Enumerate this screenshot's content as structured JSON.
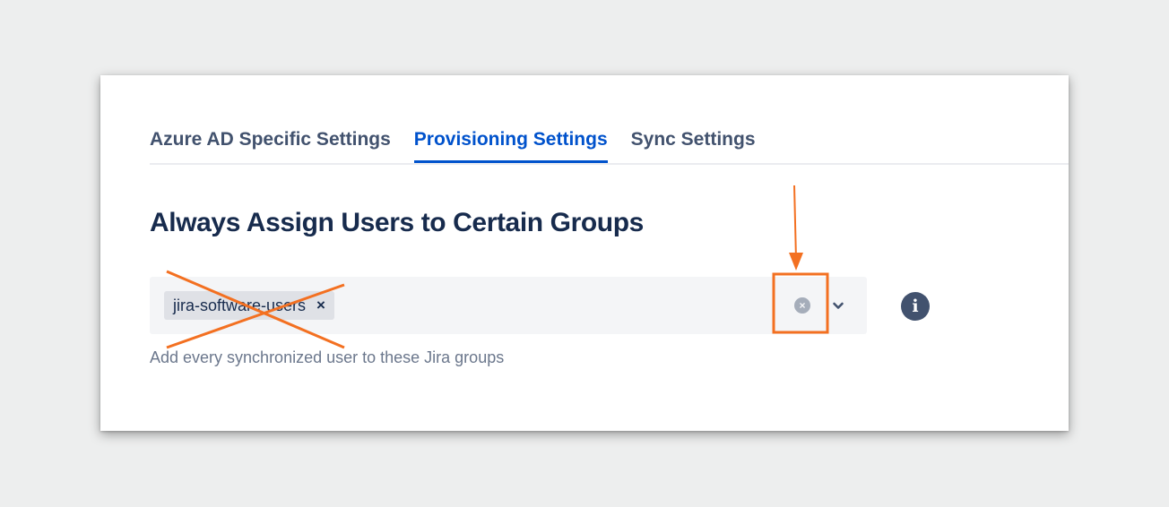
{
  "tabs": [
    {
      "label": "Azure AD Specific Settings",
      "active": false
    },
    {
      "label": "Provisioning Settings",
      "active": true
    },
    {
      "label": "Sync Settings",
      "active": false
    }
  ],
  "section": {
    "title": "Always Assign Users to Certain Groups"
  },
  "group_select": {
    "chips": [
      {
        "label": "jira-software-users",
        "remove_glyph": "×"
      }
    ],
    "clear_glyph": "×",
    "helper_text": "Add every synchronized user to these Jira groups"
  },
  "info": {
    "glyph": "i"
  },
  "colors": {
    "active_tab": "#0052cc",
    "text_primary": "#172b4d",
    "text_secondary": "#6b778c",
    "annotation": "#f37021"
  }
}
